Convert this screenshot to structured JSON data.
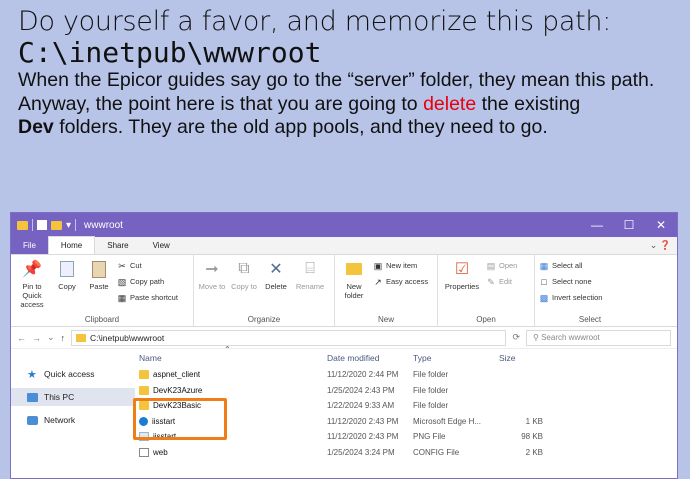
{
  "slide": {
    "title": "Do yourself a favor, and memorize this path:",
    "path": "C:\\inetpub\\wwwroot",
    "para1": "When the Epicor guides say go to the “server” folder, they mean this path.",
    "para2_a": "Anyway, the point here is that you are going to ",
    "para2_red": "delete",
    "para2_b": " the existing",
    "para3_bold": "Dev",
    "para3_rest": " folders. They are the old app pools, and they need to go."
  },
  "window": {
    "title": "wwwroot",
    "controls": [
      "—",
      "☐",
      "✕"
    ],
    "tabs": [
      "File",
      "Home",
      "Share",
      "View"
    ],
    "ribbon": {
      "clipboard": {
        "label": "Clipboard",
        "pin": "Pin to Quick access",
        "copy": "Copy",
        "paste": "Paste",
        "cut": "Cut",
        "copy_path": "Copy path",
        "paste_shortcut": "Paste shortcut"
      },
      "organize": {
        "label": "Organize",
        "move_to": "Move to",
        "copy_to": "Copy to",
        "delete": "Delete",
        "rename": "Rename"
      },
      "new": {
        "label": "New",
        "new_folder": "New folder",
        "new_item": "New item",
        "easy_access": "Easy access"
      },
      "open": {
        "label": "Open",
        "properties": "Properties",
        "open": "Open",
        "edit": "Edit"
      },
      "select": {
        "label": "Select",
        "select_all": "Select all",
        "select_none": "Select none",
        "invert": "Invert selection"
      }
    },
    "address": "C:\\inetpub\\wwwroot",
    "search_placeholder": "Search wwwroot",
    "nav": [
      "Quick access",
      "This PC",
      "Network"
    ],
    "columns": [
      "Name",
      "Date modified",
      "Type",
      "Size"
    ],
    "files": [
      {
        "name": "aspnet_client",
        "date": "11/12/2020 2:44 PM",
        "type": "File folder",
        "size": "",
        "icon": "folder"
      },
      {
        "name": "DevK23Azure",
        "date": "1/25/2024 2:43 PM",
        "type": "File folder",
        "size": "",
        "icon": "folder"
      },
      {
        "name": "DevK23Basic",
        "date": "1/22/2024 9:33 AM",
        "type": "File folder",
        "size": "",
        "icon": "folder"
      },
      {
        "name": "iisstart",
        "date": "11/12/2020 2:43 PM",
        "type": "Microsoft Edge H...",
        "size": "1 KB",
        "icon": "edge"
      },
      {
        "name": "iisstart",
        "date": "11/12/2020 2:43 PM",
        "type": "PNG File",
        "size": "98 KB",
        "icon": "png"
      },
      {
        "name": "web",
        "date": "1/25/2024 3:24 PM",
        "type": "CONFIG File",
        "size": "2 KB",
        "icon": "cfg"
      }
    ]
  }
}
